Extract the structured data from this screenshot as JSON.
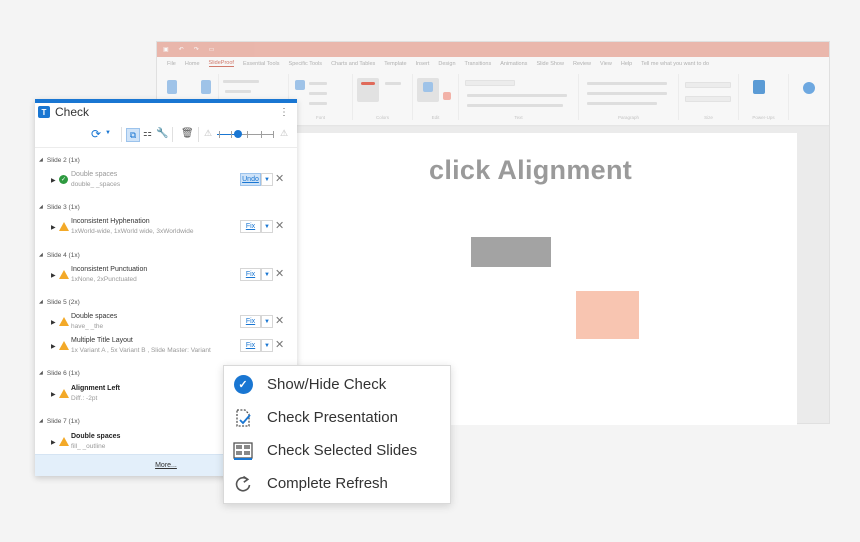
{
  "ppt": {
    "tabs": [
      "File",
      "Home",
      "SlideProof",
      "Essential Tools",
      "Specific Tools",
      "Charts and Tables",
      "Template",
      "Insert",
      "Design",
      "Transitions",
      "Animations",
      "Slide Show",
      "Review",
      "View",
      "Help",
      "Tell me what you want to do"
    ],
    "active_tab": "SlideProof",
    "ribbon_groups": [
      "Slides",
      "Font",
      "Colors",
      "Edit",
      "Text",
      "Paragraph",
      "Size",
      "Power-Ups"
    ],
    "slide_title": "click Alignment",
    "colors": {
      "title_bar": "#e9a597",
      "shape_gray": "#a3a3a3",
      "shape_peach": "#f8c5b1"
    }
  },
  "panel": {
    "logo": "T",
    "title": "Check",
    "kebab": "⋮",
    "accent": "#1976d2",
    "footer_link": "More...",
    "sections": [
      {
        "label": "Slide 2 (1x)",
        "items": [
          {
            "name": "Double spaces",
            "detail": "double_ _spaces",
            "status": "ok",
            "action": "Undo",
            "style": "muted"
          }
        ]
      },
      {
        "label": "Slide 3 (1x)",
        "items": [
          {
            "name": "Inconsistent Hyphenation",
            "detail": "1xWorld-wide, 1xWorld wide, 3xWorldwide",
            "status": "warning",
            "action": "Fix",
            "style": "normal"
          }
        ]
      },
      {
        "label": "Slide 4 (1x)",
        "items": [
          {
            "name": "Inconsistent Punctuation",
            "detail": "1xNone, 2xPunctuated",
            "status": "warning",
            "action": "Fix",
            "style": "normal"
          }
        ]
      },
      {
        "label": "Slide 5 (2x)",
        "items": [
          {
            "name": "Double spaces",
            "detail": "have_ _the",
            "status": "warning",
            "action": "Fix",
            "style": "normal"
          },
          {
            "name": "Multiple Title Layout",
            "detail": "1x Variant A , 5x Variant B , Slide Master: Variant",
            "status": "warning",
            "action": "Fix",
            "style": "normal"
          }
        ]
      },
      {
        "label": "Slide 6 (1x)",
        "items": [
          {
            "name": "Alignment Left",
            "detail": "Diff.: -2pt",
            "status": "warning",
            "action": "",
            "style": "bold"
          }
        ]
      },
      {
        "label": "Slide 7 (1x)",
        "items": [
          {
            "name": "Double spaces",
            "detail": "fill_ _outline",
            "status": "warning",
            "action": "",
            "style": "bold"
          }
        ]
      }
    ]
  },
  "menu": {
    "items": [
      {
        "label": "Show/Hide Check",
        "icon": "check-circle-icon"
      },
      {
        "label": "Check Presentation",
        "icon": "document-check-icon"
      },
      {
        "label": "Check Selected Slides",
        "icon": "slides-grid-icon"
      },
      {
        "label": "Complete Refresh",
        "icon": "refresh-icon"
      }
    ]
  }
}
